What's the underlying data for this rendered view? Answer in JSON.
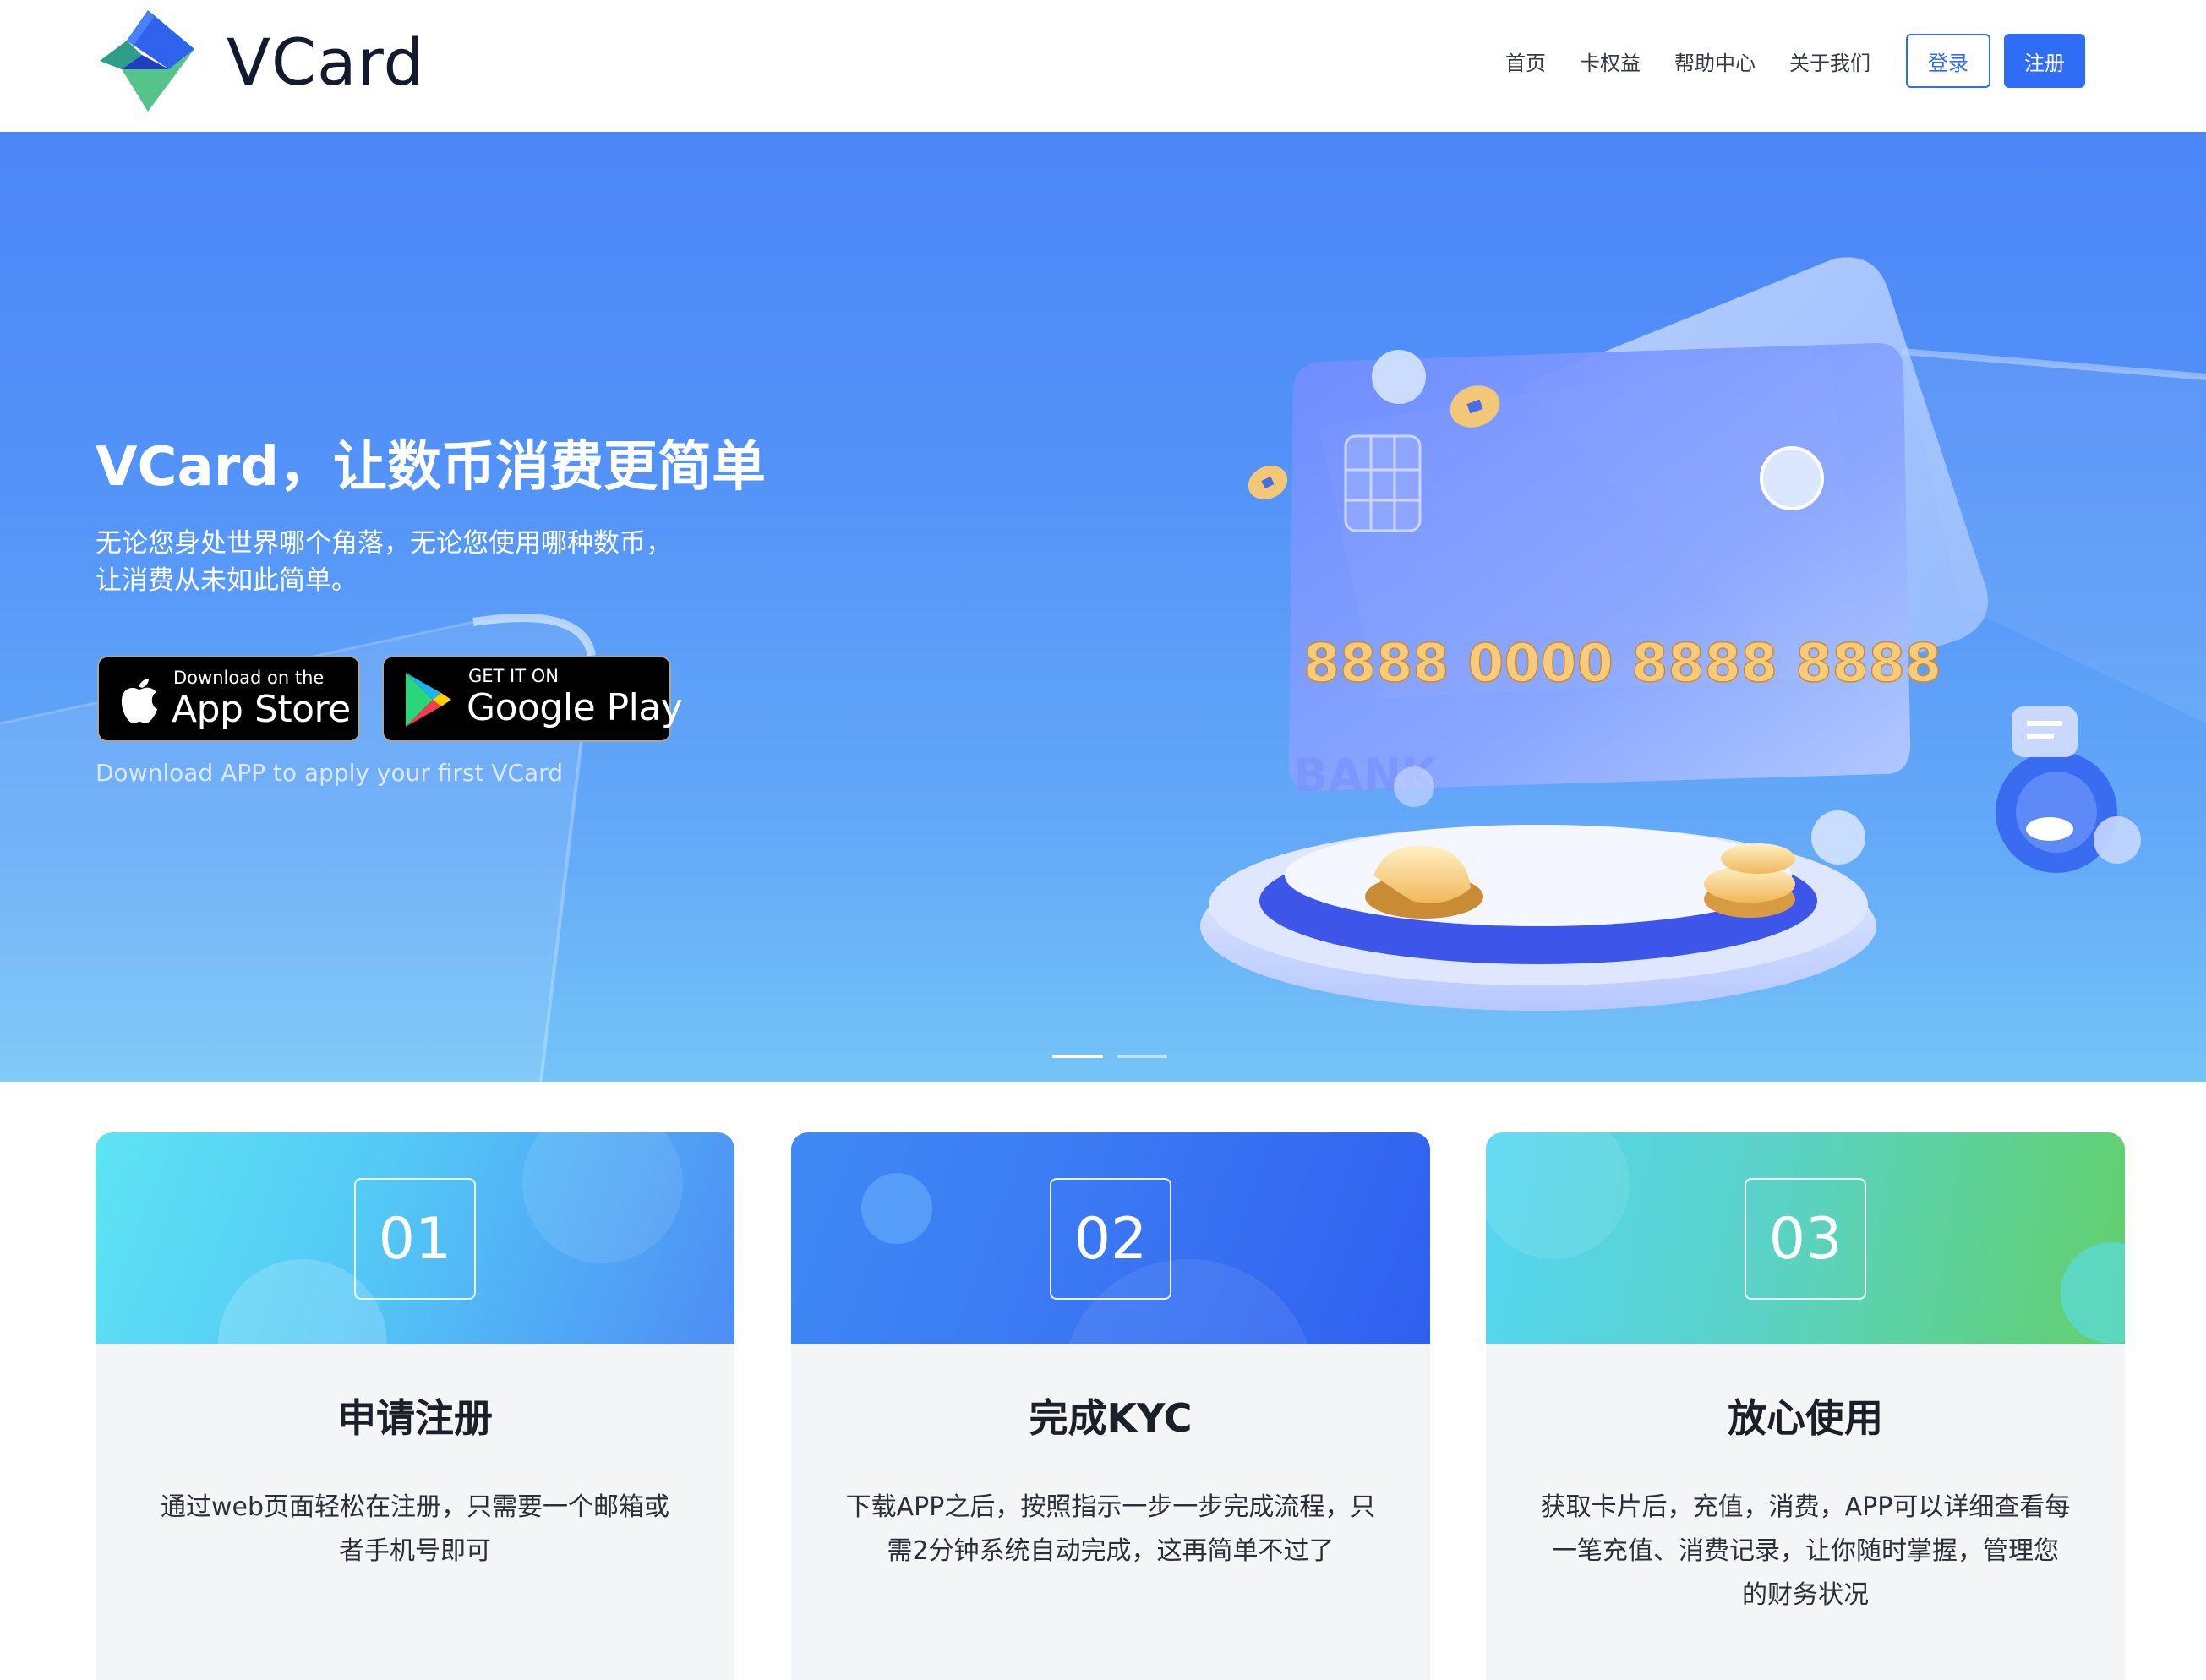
{
  "header": {
    "brand": "VCard",
    "nav": [
      "首页",
      "卡权益",
      "帮助中心",
      "关于我们"
    ],
    "login_label": "登录",
    "register_label": "注册"
  },
  "hero": {
    "title": "VCard，让数币消费更简单",
    "subtitle_line1": "无论您身处世界哪个角落，无论您使用哪种数币，",
    "subtitle_line2": "让消费从未如此简单。",
    "app_store": {
      "small": "Download on the",
      "big": "App Store"
    },
    "google_play": {
      "small": "GET IT ON",
      "big": "Google Play"
    },
    "note": "Download APP to apply your first VCard",
    "card_number": "8888 0000 8888 8888",
    "card_bank": "BANK",
    "carousel_active_index": 0,
    "carousel_count": 2
  },
  "steps": [
    {
      "number": "01",
      "title": "申请注册",
      "desc": "通过web页面轻松在注册，只需要一个邮箱或者手机号即可"
    },
    {
      "number": "02",
      "title": "完成KYC",
      "desc": "下载APP之后，按照指示一步一步完成流程，只需2分钟系统自动完成，这再简单不过了"
    },
    {
      "number": "03",
      "title": "放心使用",
      "desc": "获取卡片后，充值，消费，APP可以详细查看每一笔充值、消费记录，让你随时掌握，管理您的财务状况"
    }
  ],
  "colors": {
    "accent": "#2f6df6",
    "hero_top": "#4c86f7",
    "hero_bottom": "#74c4f8"
  }
}
